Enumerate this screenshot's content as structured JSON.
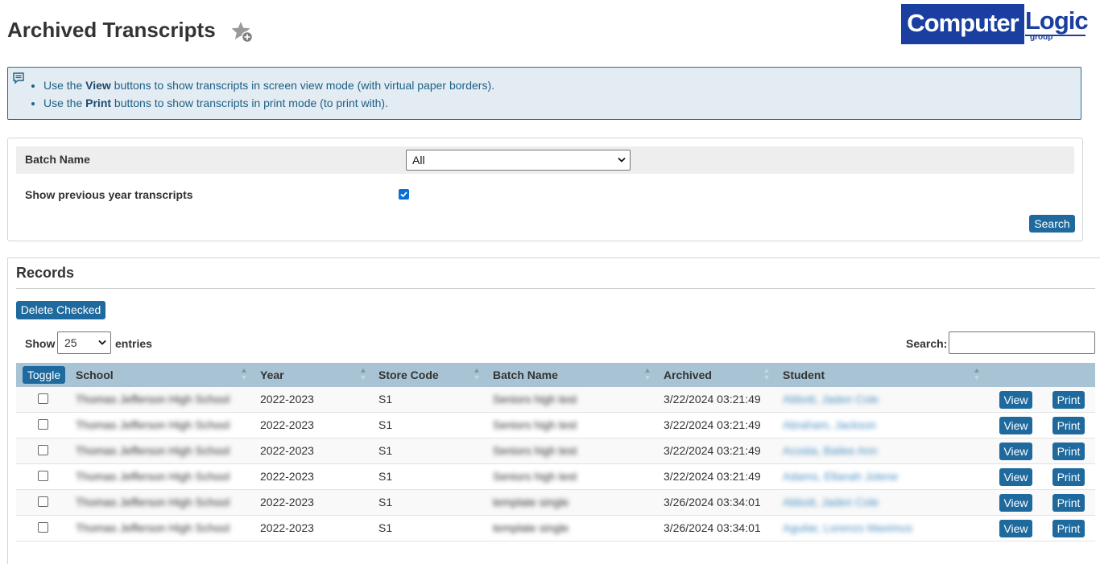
{
  "page": {
    "title": "Archived Transcripts"
  },
  "logo": {
    "word1": "Computer",
    "word2": "Logic",
    "word3": "group"
  },
  "info": {
    "line1": {
      "pre": "Use the ",
      "bold": "View",
      "post": " buttons to show transcripts in screen view mode (with virtual paper borders)."
    },
    "line2": {
      "pre": "Use the ",
      "bold": "Print",
      "post": " buttons to show transcripts in print mode (to print with)."
    }
  },
  "filters": {
    "batch_label": "Batch Name",
    "batch_value": "All",
    "prev_year_label": "Show previous year transcripts",
    "prev_year_checked": true,
    "search_button": "Search"
  },
  "records": {
    "title": "Records",
    "delete_button": "Delete Checked",
    "show_label": "Show",
    "entries_value": "25",
    "entries_label": "entries",
    "search_label": "Search:",
    "toggle_button": "Toggle",
    "columns": {
      "school": "School",
      "year": "Year",
      "store": "Store Code",
      "batch": "Batch Name",
      "archived": "Archived",
      "student": "Student"
    },
    "view_label": "View",
    "print_label": "Print",
    "rows": [
      {
        "school": "Thomas Jefferson High School",
        "year": "2022-2023",
        "store": "S1",
        "batch": "Seniors high test",
        "archived": "3/22/2024 03:21:49",
        "student": "Abbott, Jaden Cole"
      },
      {
        "school": "Thomas Jefferson High School",
        "year": "2022-2023",
        "store": "S1",
        "batch": "Seniors high test",
        "archived": "3/22/2024 03:21:49",
        "student": "Abraham, Jackson"
      },
      {
        "school": "Thomas Jefferson High School",
        "year": "2022-2023",
        "store": "S1",
        "batch": "Seniors high test",
        "archived": "3/22/2024 03:21:49",
        "student": "Acosta, Bailee Ann"
      },
      {
        "school": "Thomas Jefferson High School",
        "year": "2022-2023",
        "store": "S1",
        "batch": "Seniors high test",
        "archived": "3/22/2024 03:21:49",
        "student": "Adams, Ellanah Jolene"
      },
      {
        "school": "Thomas Jefferson High School",
        "year": "2022-2023",
        "store": "S1",
        "batch": "template single",
        "archived": "3/26/2024 03:34:01",
        "student": "Abbott, Jaden Cole"
      },
      {
        "school": "Thomas Jefferson High School",
        "year": "2022-2023",
        "store": "S1",
        "batch": "template single",
        "archived": "3/26/2024 03:34:01",
        "student": "Aguilar, Lorenzo Maximus"
      }
    ]
  }
}
